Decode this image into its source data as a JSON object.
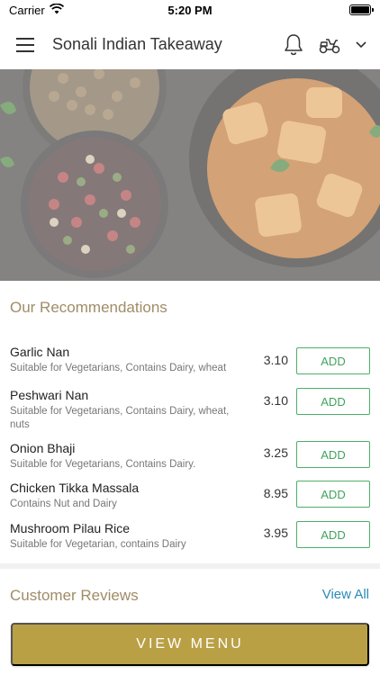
{
  "status_bar": {
    "carrier": "Carrier",
    "time": "5:20 PM"
  },
  "app_bar": {
    "title": "Sonali Indian Takeaway"
  },
  "recommendations": {
    "title": "Our Recommendations",
    "items": [
      {
        "name": "Garlic Nan",
        "description": "Suitable for Vegetarians, Contains Dairy, wheat",
        "price": "3.10",
        "button": "ADD"
      },
      {
        "name": "Peshwari Nan",
        "description": "Suitable for Vegetarians, Contains Dairy, wheat, nuts",
        "price": "3.10",
        "button": "ADD"
      },
      {
        "name": "Onion Bhaji",
        "description": "Suitable for Vegetarians, Contains Dairy.",
        "price": "3.25",
        "button": "ADD"
      },
      {
        "name": "Chicken Tikka Massala",
        "description": "Contains Nut and Dairy",
        "price": "8.95",
        "button": "ADD"
      },
      {
        "name": "Mushroom Pilau Rice",
        "description": "Suitable for Vegetarian, contains Dairy",
        "price": "3.95",
        "button": "ADD"
      }
    ]
  },
  "reviews": {
    "title": "Customer Reviews",
    "view_all": "View All"
  },
  "footer": {
    "view_menu": "VIEW MENU"
  },
  "colors": {
    "accent_gold": "#b9a045",
    "section_title": "#a08c67",
    "add_green": "#4caf6a",
    "link_blue": "#2a8ab8"
  },
  "icons": [
    "wifi-icon",
    "battery-icon",
    "hamburger-menu-icon",
    "bell-icon",
    "delivery-scooter-icon",
    "chevron-down-icon"
  ]
}
